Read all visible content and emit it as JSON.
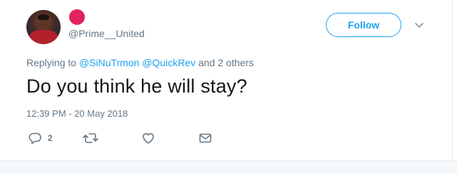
{
  "user": {
    "handle": "@Prime__United"
  },
  "header": {
    "follow_label": "Follow"
  },
  "reply_context": {
    "prefix": "Replying to",
    "mention_1": "@SiNuTrmon",
    "mention_2": "@QuickRev",
    "suffix": "and 2 others"
  },
  "tweet": {
    "text": "Do you think he will stay?",
    "timestamp": "12:39 PM - 20 May 2018"
  },
  "actions": {
    "reply_count": "2",
    "icons": [
      "reply-icon",
      "retweet-icon",
      "like-icon",
      "direct-message-icon"
    ]
  },
  "colors": {
    "accent": "#1da1f2",
    "secondary_text": "#657786",
    "name_badge": "#e0245e"
  }
}
